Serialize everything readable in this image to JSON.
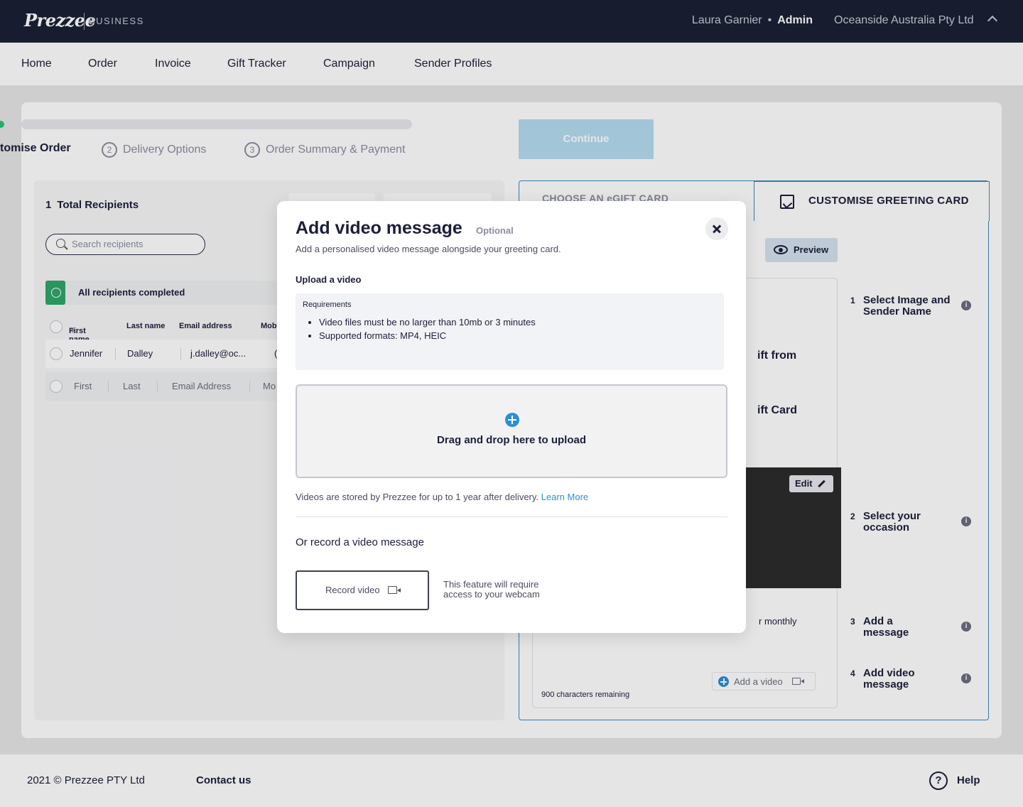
{
  "header": {
    "logo": "Prezzee",
    "logo_sub": "BUSINESS",
    "user_name": "Laura Garnier",
    "separator": "•",
    "role": "Admin",
    "company": "Oceanside Australia Pty Ltd"
  },
  "nav": {
    "items": [
      "Home",
      "Order",
      "Invoice",
      "Gift Tracker",
      "Campaign",
      "Sender Profiles"
    ]
  },
  "stepper": {
    "current_label": "tomise Order",
    "steps": [
      {
        "num": "2",
        "label": "Delivery Options"
      },
      {
        "num": "3",
        "label": "Order Summary & Payment"
      }
    ],
    "continue_label": "Continue"
  },
  "recipients": {
    "count": "1",
    "title": "Total Recipients",
    "search_placeholder": "Search recipients",
    "all_completed": "All recipients completed",
    "columns": [
      "First name",
      "Last name",
      "Email address",
      "Mob"
    ],
    "sort_glyph": "▼",
    "rows": [
      [
        "Jennifer",
        "Dalley",
        "j.dalley@oc...",
        "("
      ],
      [
        "First",
        "Last",
        "Email Address",
        "Mo"
      ]
    ]
  },
  "right_panel": {
    "tab_choose": "CHOOSE AN eGIFT CARD",
    "tab_customise": "CUSTOMISE GREETING CARD",
    "preview_label": "Preview",
    "card_gift_from": "ift from",
    "card_gift_card": "ift Card",
    "edit_label": "Edit",
    "monthly_text": "r monthly",
    "chars_remaining": "900 characters remaining",
    "add_video_label": "Add a video",
    "steps": [
      {
        "n": "1",
        "label": "Select Image and Sender Name"
      },
      {
        "n": "2",
        "label": "Select your occasion"
      },
      {
        "n": "3",
        "label": "Add a message"
      },
      {
        "n": "4",
        "label": "Add video message"
      }
    ]
  },
  "modal": {
    "title": "Add video message",
    "optional": "Optional",
    "subtitle": "Add a personalised video message alongside your greeting card.",
    "upload_heading": "Upload a video",
    "requirements_heading": "Requirements",
    "requirements": [
      "Video files must be no larger than 10mb or 3 minutes",
      "Supported formats: MP4, HEIC"
    ],
    "drop_label": "Drag and drop here to upload",
    "storage_note": "Videos are stored by Prezzee for up to 1 year after delivery.",
    "learn_more": "Learn More",
    "record_heading": "Or record a video message",
    "record_button": "Record video",
    "webcam_note": "This feature will require access to your webcam"
  },
  "footer": {
    "copyright": "2021 © Prezzee PTY Ltd",
    "contact": "Contact us",
    "help_glyph": "?",
    "help": "Help"
  },
  "colors": {
    "header_bg": "#1b2035",
    "accent_blue": "#2b8fd6",
    "success_green": "#2fa66a",
    "continue_disabled": "#b5dcf1",
    "panel_border": "#3a88b8"
  }
}
